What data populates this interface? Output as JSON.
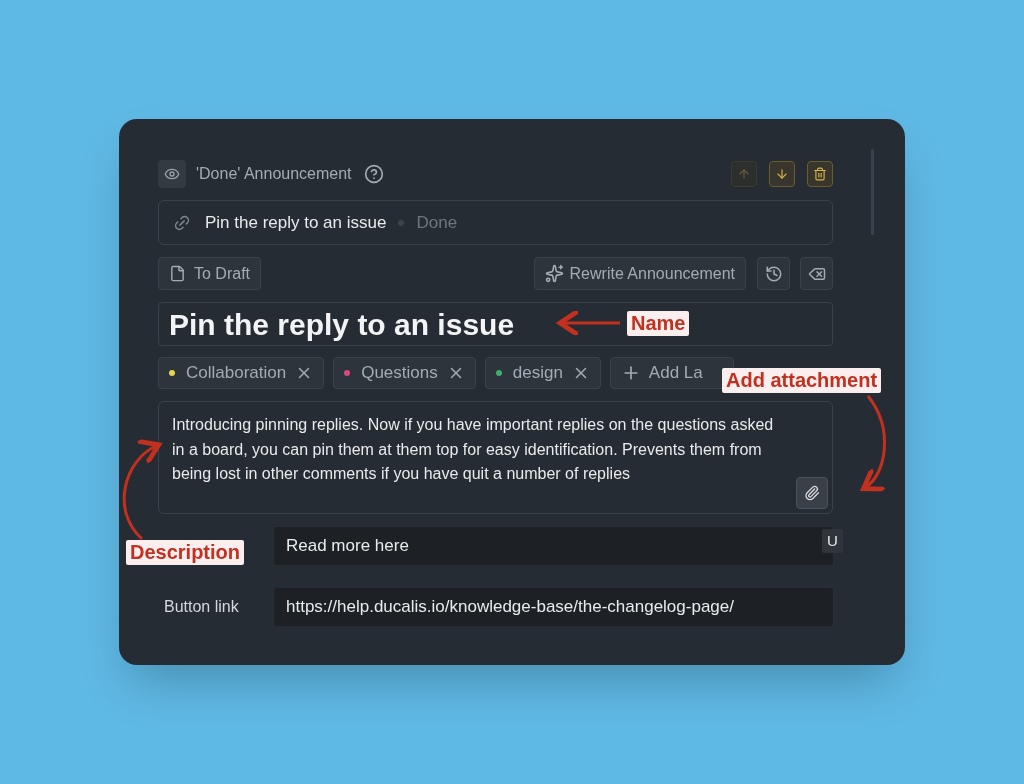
{
  "header": {
    "title": "'Done' Announcement",
    "buttons": [
      {
        "kind": "up",
        "disabled": true
      },
      {
        "kind": "down",
        "disabled": false
      },
      {
        "kind": "delete",
        "disabled": false
      }
    ]
  },
  "linked_issue": {
    "title": "Pin the reply to an issue",
    "status": "Done"
  },
  "toolbar": {
    "draft_button": "To Draft",
    "rewrite_button": "Rewrite Announcement"
  },
  "name_field": {
    "value": "Pin the reply to an issue"
  },
  "labels": [
    {
      "text": "Collaboration",
      "color": "#e8d44d"
    },
    {
      "text": "Questions",
      "color": "#e0487a"
    },
    {
      "text": "design",
      "color": "#3fae6a"
    }
  ],
  "add_label": "Add La",
  "description": {
    "value": "Introducing pinning replies. Now if you have important replies on the questions asked in a board, you can pin them at them top for easy identification. Prevents them from being lost in other comments if you have quit a number of replies"
  },
  "button_text": {
    "value": "Read more here",
    "badge": "U"
  },
  "button_link": {
    "label": "Button link",
    "value": "https://help.ducalis.io/knowledge-base/the-changelog-page/"
  },
  "annotations": [
    {
      "kind": "name",
      "text": "Name"
    },
    {
      "kind": "attachment",
      "text": "Add attachment"
    },
    {
      "kind": "description",
      "text": "Description"
    }
  ]
}
